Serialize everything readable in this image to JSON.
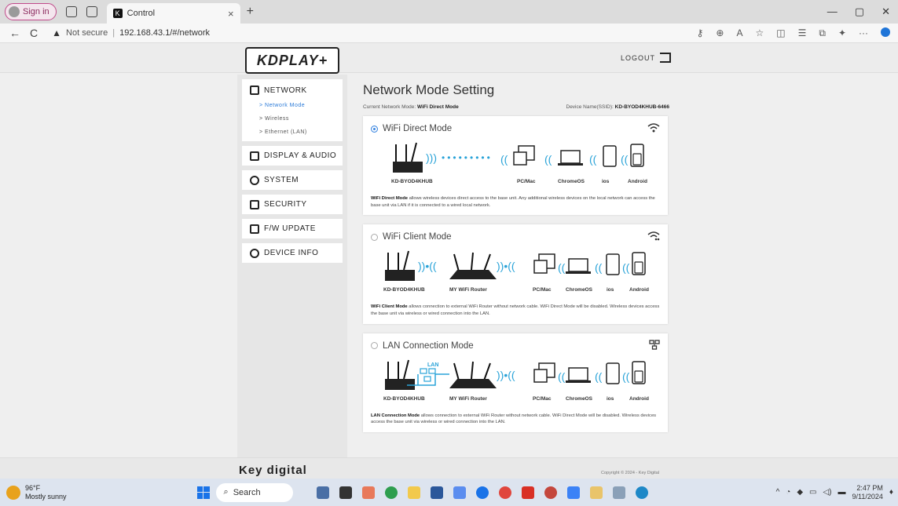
{
  "browser": {
    "signin_label": "Sign in",
    "tab_title": "Control",
    "tab_close": "×",
    "new_tab": "+",
    "back": "←",
    "refresh": "C",
    "not_secure": "Not secure",
    "url": "192.168.43.1/#/network",
    "more": "···"
  },
  "header": {
    "logo_text": "KDPLAY+",
    "logout_label": "LOGOUT"
  },
  "sidebar": {
    "items": [
      {
        "label": "NETWORK",
        "icon": "network-icon"
      },
      {
        "label": "DISPLAY & AUDIO",
        "icon": "display-icon"
      },
      {
        "label": "SYSTEM",
        "icon": "gear-icon"
      },
      {
        "label": "SECURITY",
        "icon": "lock-icon"
      },
      {
        "label": "F/W UPDATE",
        "icon": "upload-icon"
      },
      {
        "label": "DEVICE INFO",
        "icon": "info-icon"
      }
    ],
    "network_sub": [
      {
        "label": "> Network Mode",
        "active": true
      },
      {
        "label": "> Wireless",
        "active": false
      },
      {
        "label": "> Ethernet (LAN)",
        "active": false
      }
    ]
  },
  "main": {
    "title": "Network Mode Setting",
    "current_mode_label": "Current Network Mode:",
    "current_mode_value": "WiFi Direct Mode",
    "device_name_label": "Device Name(SSID):",
    "device_name_value": "KD-BYOD4KHUB-6466",
    "modes": [
      {
        "title": "WiFi Direct Mode",
        "selected": true,
        "icon": "wifi-icon",
        "labels": [
          "KD-BYOD4KHUB",
          "PC/Mac",
          "ChromeOS",
          "ios",
          "Android"
        ],
        "desc_bold": "WiFi Direct Mode",
        "desc": " allows wireless devices direct access to the base unit. Any additional wireless devices on the local network can access the base unit via LAN if it is connected to a wired local network."
      },
      {
        "title": "WiFi Client Mode",
        "selected": false,
        "icon": "wifi-client-icon",
        "labels": [
          "KD-BYOD4KHUB",
          "MY WiFi Router",
          "PC/Mac",
          "ChromeOS",
          "ios",
          "Android"
        ],
        "desc_bold": "WiFi Client Mode",
        "desc": " allows connection to external WiFi Router without network cable. WiFi Direct Mode will be disabled. Wireless devices access the base unit via wireless or wired connection into the LAN."
      },
      {
        "title": "LAN Connection Mode",
        "selected": false,
        "icon": "lan-icon",
        "labels": [
          "KD-BYOD4KHUB",
          "MY WiFi Router",
          "PC/Mac",
          "ChromeOS",
          "ios",
          "Android"
        ],
        "lan_label": "LAN",
        "desc_bold": "LAN Connection Mode",
        "desc": " allows connection to external WiFi Router without network cable. WiFi Direct Mode will be disabled. Wireless devices access the base unit via wireless or wired connection into the LAN."
      }
    ]
  },
  "footer": {
    "brand": "Key digital",
    "copyright": "Copyright © 2024 - Key Digital"
  },
  "taskbar": {
    "weather_temp": "96°F",
    "weather_desc": "Mostly sunny",
    "search_label": "Search",
    "time": "2:47 PM",
    "date": "9/11/2024"
  }
}
